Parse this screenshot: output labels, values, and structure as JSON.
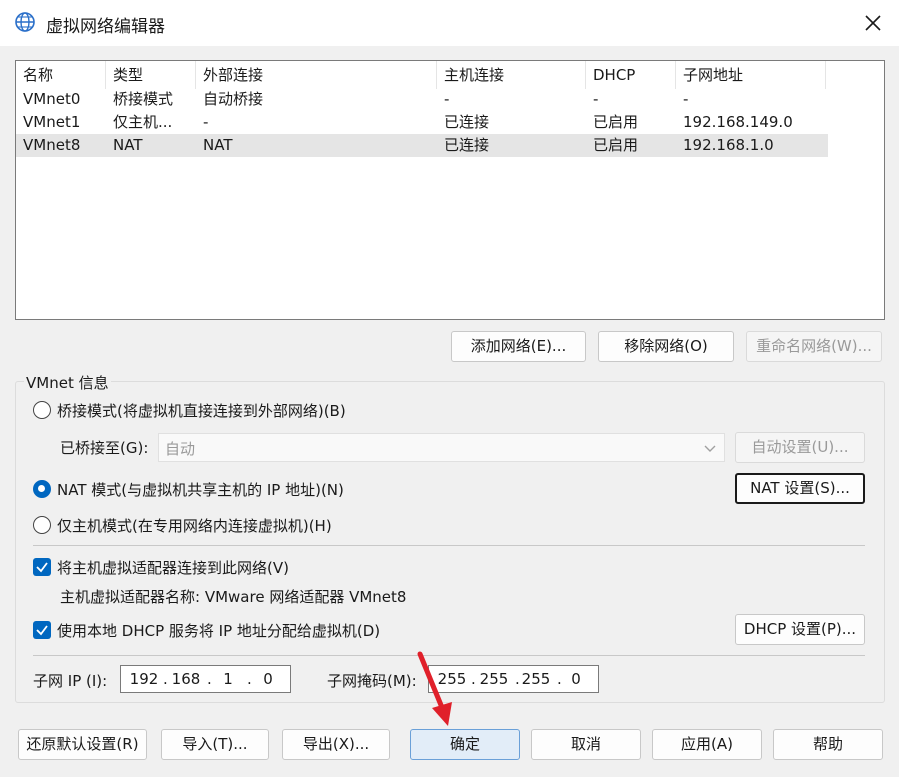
{
  "window": {
    "title": "虚拟网络编辑器",
    "icon": "globe-icon",
    "close_icon": "close-icon"
  },
  "network_list": {
    "columns": [
      "名称",
      "类型",
      "外部连接",
      "主机连接",
      "DHCP",
      "子网地址"
    ],
    "rows": [
      {
        "name": "VMnet0",
        "type": "桥接模式",
        "external": "自动桥接",
        "host": "-",
        "dhcp": "-",
        "subnet": "-"
      },
      {
        "name": "VMnet1",
        "type": "仅主机...",
        "external": "-",
        "host": "已连接",
        "dhcp": "已启用",
        "subnet": "192.168.149.0"
      },
      {
        "name": "VMnet8",
        "type": "NAT",
        "external": "NAT",
        "host": "已连接",
        "dhcp": "已启用",
        "subnet": "192.168.1.0"
      }
    ],
    "selected_row": "VMnet8"
  },
  "list_buttons": {
    "add": "添加网络(E)...",
    "remove": "移除网络(O)",
    "rename": "重命名网络(W)..."
  },
  "vmnet_info": {
    "group_label": "VMnet 信息",
    "bridged_label": "桥接模式(将虚拟机直接连接到外部网络)(B)",
    "bridged_to_label": "已桥接至(G):",
    "bridged_to_value": "自动",
    "auto_settings": "自动设置(U)...",
    "nat_label": "NAT 模式(与虚拟机共享主机的 IP 地址)(N)",
    "nat_settings": "NAT 设置(S)...",
    "hostonly_label": "仅主机模式(在专用网络内连接虚拟机)(H)",
    "selected_mode": "nat",
    "connect_adapter_label": "将主机虚拟适配器连接到此网络(V)",
    "connect_adapter_checked": true,
    "adapter_name_label": "主机虚拟适配器名称: VMware 网络适配器 VMnet8",
    "dhcp_label": "使用本地 DHCP 服务将 IP 地址分配给虚拟机(D)",
    "dhcp_checked": true,
    "dhcp_settings": "DHCP 设置(P)...",
    "subnet_ip_label": "子网 IP (I):",
    "subnet_ip": [
      "192",
      "168",
      "1",
      "0"
    ],
    "subnet_mask_label": "子网掩码(M):",
    "subnet_mask": [
      "255",
      "255",
      "255",
      "0"
    ]
  },
  "footer": {
    "restore": "还原默认设置(R)",
    "import": "导入(T)...",
    "export": "导出(X)...",
    "ok": "确定",
    "cancel": "取消",
    "apply": "应用(A)",
    "help": "帮助"
  },
  "annotation": {
    "arrow_color": "#e0202a",
    "arrow_target": "ok-button"
  }
}
